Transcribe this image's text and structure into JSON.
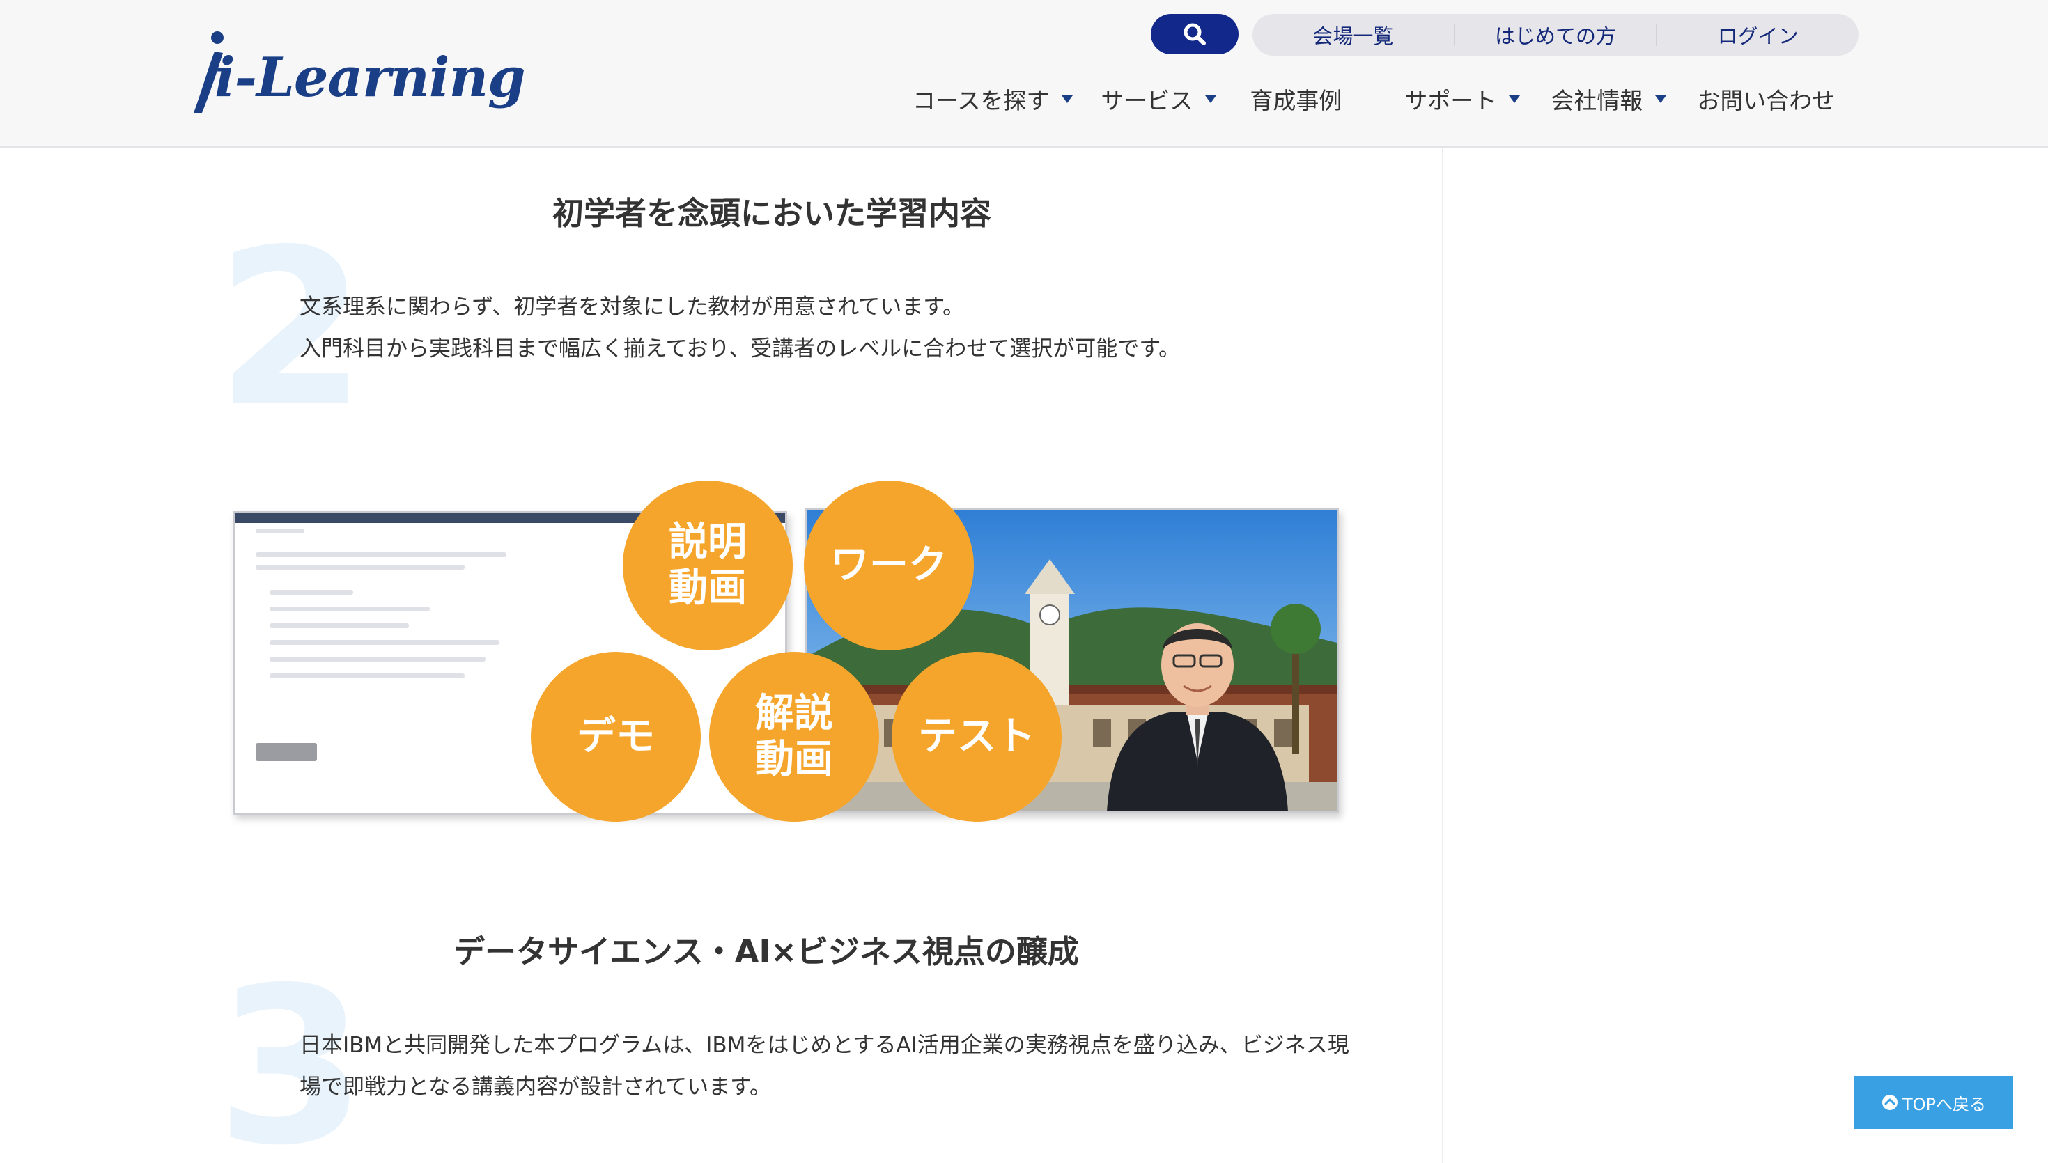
{
  "brand": {
    "logo_text": "i-Learning",
    "color": "#1b3f86"
  },
  "header": {
    "search_icon": "search-icon",
    "utility_links": [
      {
        "label": "会場一覧"
      },
      {
        "label": "はじめての方"
      },
      {
        "label": "ログイン"
      }
    ],
    "nav": [
      {
        "label": "コースを探す",
        "has_dropdown": true
      },
      {
        "label": "サービス",
        "has_dropdown": true
      },
      {
        "label": "育成事例",
        "has_dropdown": false
      },
      {
        "label": "サポート",
        "has_dropdown": true
      },
      {
        "label": "会社情報",
        "has_dropdown": true
      },
      {
        "label": "お問い合わせ",
        "has_dropdown": false
      }
    ]
  },
  "sections": [
    {
      "number": "2",
      "title": "初学者を念頭においた学習内容",
      "lines": [
        "文系理系に関わらず、初学者を対象にした教材が用意されています。",
        "入門科目から実践科目まで幅広く揃えており、受講者のレベルに合わせて選択が可能です。"
      ]
    },
    {
      "number": "3",
      "title": "データサイエンス・AI×ビジネス視点の醸成",
      "lines": [
        "日本IBMと共同開発した本プログラムは、IBMをはじめとするAI活用企業の実務視点を盛り込み、ビジネス現",
        "場で即戦力となる講義内容が設計されています。"
      ]
    }
  ],
  "illustration": {
    "circles": [
      {
        "label": "説明\n動画"
      },
      {
        "label": "ワーク"
      },
      {
        "label": "デモ"
      },
      {
        "label": "解説\n動画"
      },
      {
        "label": "テスト"
      }
    ],
    "circle_color": "#f6a52c"
  },
  "back_to_top": {
    "label": "TOPへ戻る",
    "color": "#3aa0e4"
  }
}
